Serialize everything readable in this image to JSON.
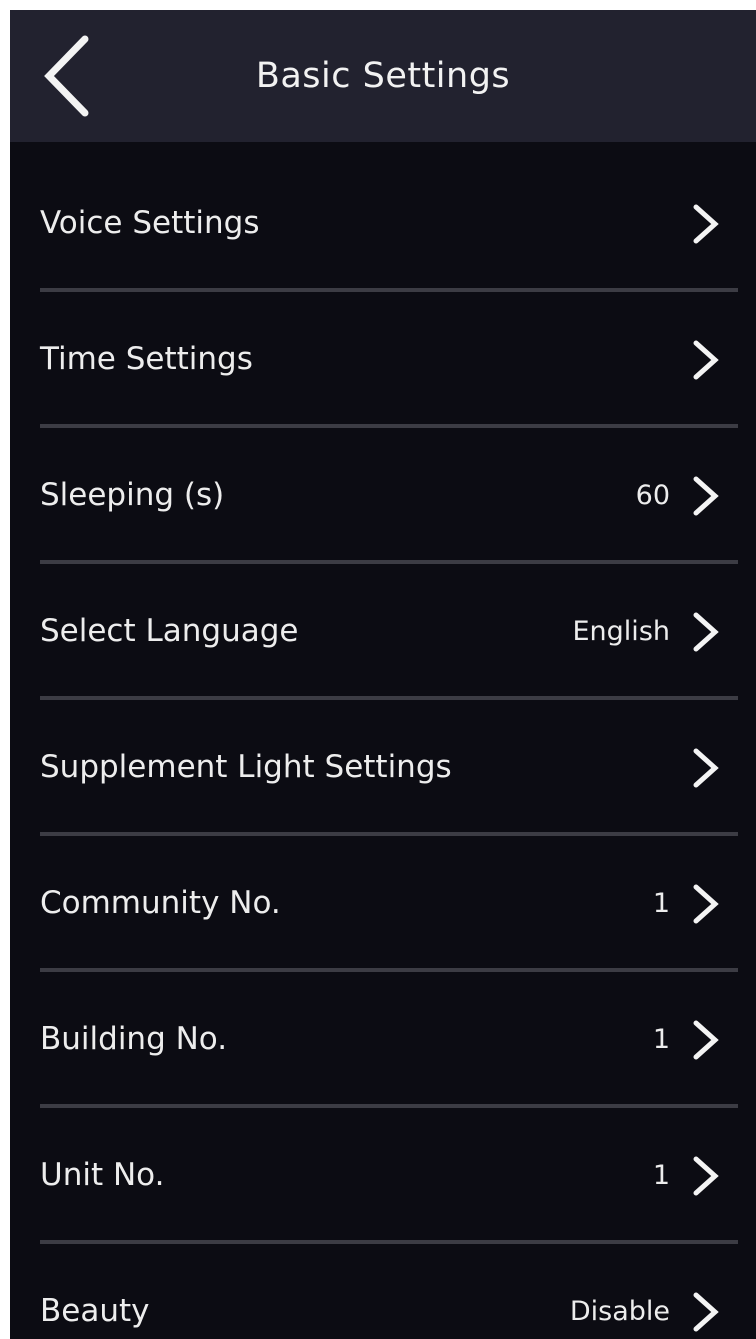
{
  "header": {
    "title": "Basic Settings",
    "back_icon": "chevron-left-icon"
  },
  "settings": {
    "items": [
      {
        "label": "Voice Settings",
        "value": ""
      },
      {
        "label": "Time Settings",
        "value": ""
      },
      {
        "label": "Sleeping (s)",
        "value": "60"
      },
      {
        "label": "Select Language",
        "value": "English"
      },
      {
        "label": "Supplement Light Settings",
        "value": ""
      },
      {
        "label": "Community No.",
        "value": "1"
      },
      {
        "label": "Building No.",
        "value": "1"
      },
      {
        "label": "Unit No.",
        "value": "1"
      },
      {
        "label": "Beauty",
        "value": "Disable"
      }
    ],
    "row_icon": "chevron-right-icon"
  },
  "colors": {
    "background": "#0c0c13",
    "header_background": "#22222f",
    "text": "#ededed",
    "divider": "#3c3c44"
  }
}
